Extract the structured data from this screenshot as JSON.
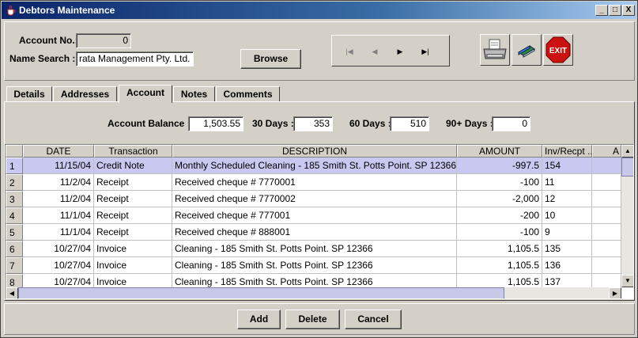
{
  "window": {
    "title": "Debtors Maintenance",
    "controls": {
      "minimize": "_",
      "maximize": "□",
      "close": "X"
    }
  },
  "header": {
    "account_no_label": "Account No.:",
    "account_no_value": "0",
    "name_search_label": "Name Search :",
    "name_search_value": "rata Management Pty. Ltd.",
    "browse_label": "Browse",
    "exit_label": "EXIT"
  },
  "navigator": {
    "first": "|◀",
    "prev": "◀",
    "next": "▶",
    "last": "▶|"
  },
  "tabs": [
    {
      "label": "Details"
    },
    {
      "label": "Addresses"
    },
    {
      "label": "Account"
    },
    {
      "label": "Notes"
    },
    {
      "label": "Comments"
    }
  ],
  "balances": {
    "account_balance_label": "Account Balance :",
    "account_balance_value": "1,503.55",
    "d30_label": "30 Days :",
    "d30_value": "353",
    "d60_label": "60 Days :",
    "d60_value": "510",
    "d90_label": "90+ Days :",
    "d90_value": "0"
  },
  "table": {
    "columns": [
      "DATE",
      "Transaction",
      "DESCRIPTION",
      "AMOUNT",
      "Inv/Recpt ...",
      "A"
    ],
    "rows": [
      {
        "n": "1",
        "date": "11/15/04",
        "trans": "Credit Note",
        "desc": "Monthly Scheduled Cleaning - 185 Smith St. Potts Point. SP 12366",
        "amount": "-997.5",
        "inv": "154"
      },
      {
        "n": "2",
        "date": "11/2/04",
        "trans": "Receipt",
        "desc": "Received cheque # 7770001",
        "amount": "-100",
        "inv": "11"
      },
      {
        "n": "3",
        "date": "11/2/04",
        "trans": "Receipt",
        "desc": "Received cheque # 7770002",
        "amount": "-2,000",
        "inv": "12"
      },
      {
        "n": "4",
        "date": "11/1/04",
        "trans": "Receipt",
        "desc": "Received cheque # 777001",
        "amount": "-200",
        "inv": "10"
      },
      {
        "n": "5",
        "date": "11/1/04",
        "trans": "Receipt",
        "desc": "Received cheque # 888001",
        "amount": "-100",
        "inv": "9"
      },
      {
        "n": "6",
        "date": "10/27/04",
        "trans": "Invoice",
        "desc": "Cleaning - 185 Smith St. Potts Point. SP 12366",
        "amount": "1,105.5",
        "inv": "135"
      },
      {
        "n": "7",
        "date": "10/27/04",
        "trans": "Invoice",
        "desc": "Cleaning - 185 Smith St. Potts Point. SP 12366",
        "amount": "1,105.5",
        "inv": "136"
      },
      {
        "n": "8",
        "date": "10/27/04",
        "trans": "Invoice",
        "desc": "Cleaning - 185 Smith St. Potts Point. SP 12366",
        "amount": "1,105.5",
        "inv": "137"
      }
    ]
  },
  "footer": {
    "add_label": "Add",
    "delete_label": "Delete",
    "cancel_label": "Cancel"
  },
  "colors": {
    "title_start": "#0a246a",
    "title_end": "#a6caf0",
    "selected_row": "#c8c8f0",
    "exit_red": "#cc1111"
  }
}
